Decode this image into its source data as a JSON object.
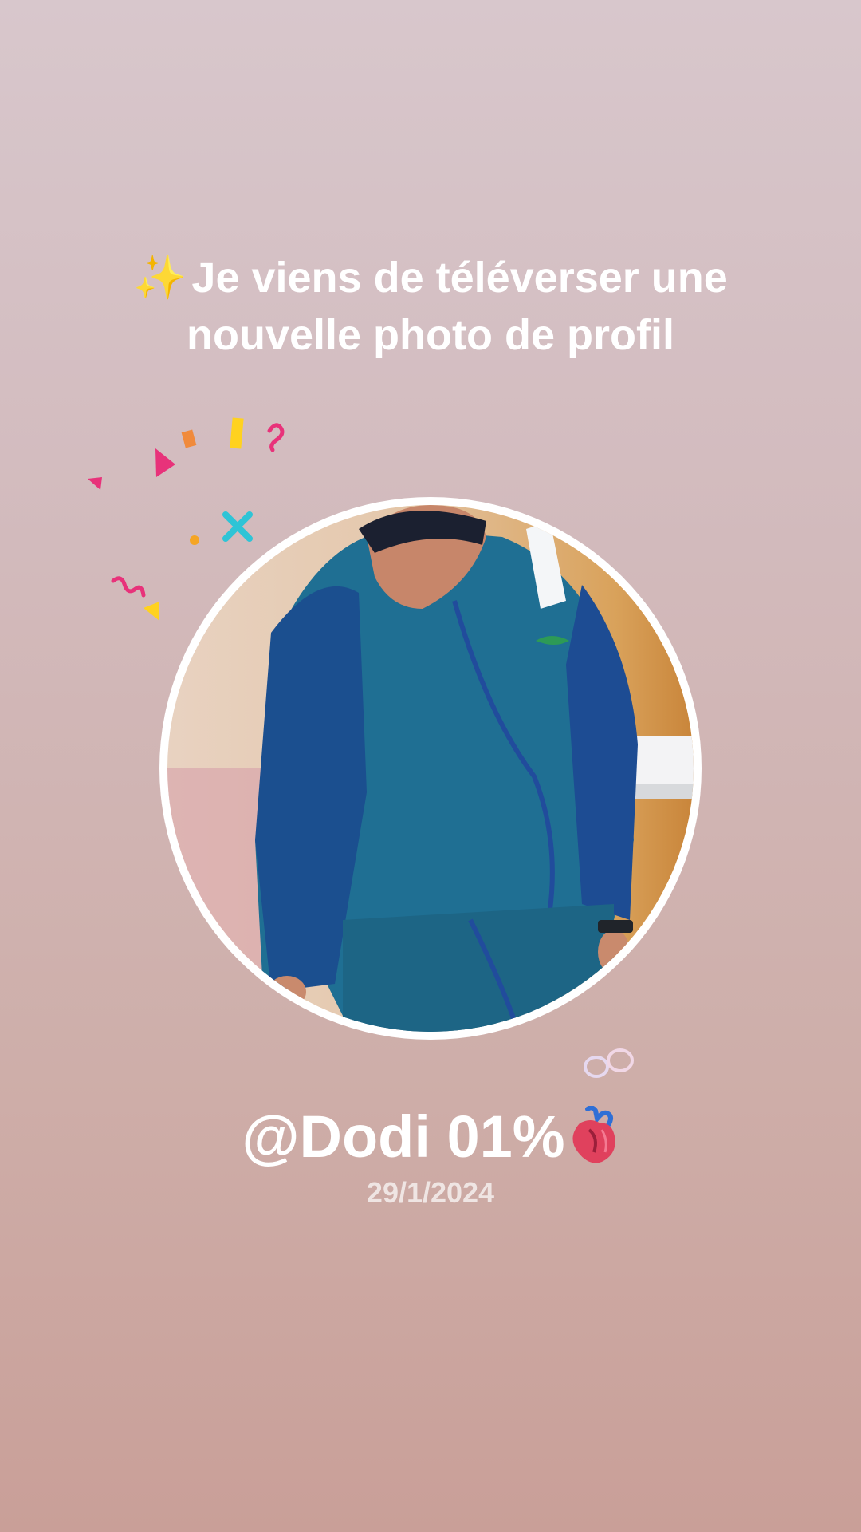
{
  "post": {
    "headline_icon": "sparkles-icon",
    "headline": "Je viens de téléverser une nouvelle photo de profil",
    "username": "@Dodi 01%",
    "username_icon": "anatomical-heart-icon",
    "date": "29/1/2024"
  },
  "colors": {
    "background_top": "#d8c7cc",
    "background_bottom": "#c99f98",
    "text": "#ffffff",
    "confetti_pink": "#e8327a",
    "confetti_yellow": "#ffd21f",
    "confetti_cyan": "#2ec4d6",
    "confetti_orange": "#f08a3c"
  }
}
